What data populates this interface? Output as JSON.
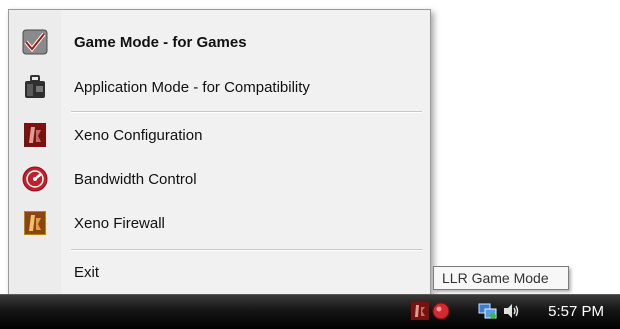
{
  "menu": {
    "items": [
      {
        "label": "Game Mode - for Games",
        "icon": "checkmark-shield-icon"
      },
      {
        "label": "Application Mode - for Compatibility",
        "icon": "briefcase-icon"
      },
      {
        "label": "Xeno Configuration",
        "icon": "xeno-logo-icon"
      },
      {
        "label": "Bandwidth Control",
        "icon": "speedometer-icon"
      },
      {
        "label": "Xeno Firewall",
        "icon": "xeno-firewall-icon"
      },
      {
        "label": "Exit"
      }
    ]
  },
  "tooltip": {
    "text": "LLR Game Mode"
  },
  "taskbar": {
    "clock": "5:57 PM",
    "tray_icons": [
      "xeno-tray-icon",
      "game-mode-tray-icon",
      "network-icon",
      "volume-icon"
    ]
  },
  "colors": {
    "menu_bg": "#f1f1f1",
    "taskbar_bg": "#000000",
    "xeno_red": "#b01e1e"
  }
}
